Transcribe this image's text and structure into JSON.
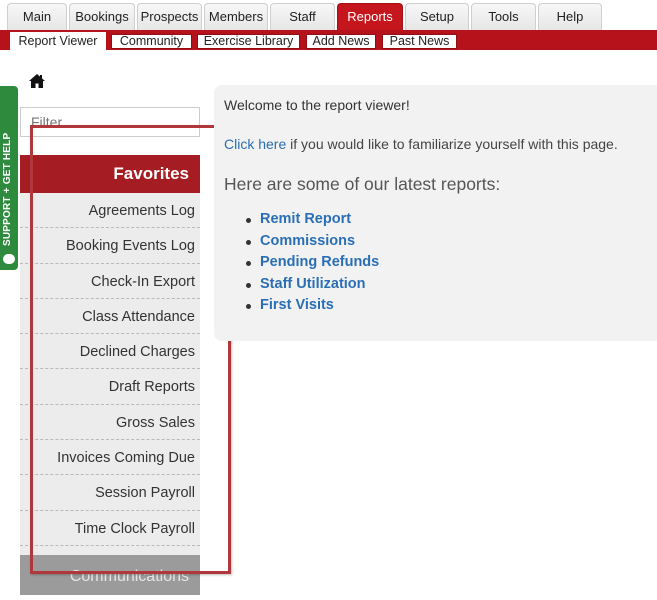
{
  "nav": {
    "tabs": [
      {
        "label": "Main"
      },
      {
        "label": "Bookings"
      },
      {
        "label": "Prospects"
      },
      {
        "label": "Members"
      },
      {
        "label": "Staff"
      },
      {
        "label": "Reports",
        "active": true
      },
      {
        "label": "Setup"
      },
      {
        "label": "Tools"
      },
      {
        "label": "Help"
      }
    ]
  },
  "subnav": {
    "tabs": [
      {
        "label": "Report Viewer",
        "active": true
      },
      {
        "label": "Community"
      },
      {
        "label": "Exercise Library"
      },
      {
        "label": "Add News"
      },
      {
        "label": "Past News"
      }
    ]
  },
  "support": {
    "label": "SUPPORT + GET HELP",
    "icon": "chat-bubble-icon"
  },
  "sidebar": {
    "home_icon": "home-icon",
    "filter_placeholder": "Filter",
    "favorites_heading": "Favorites",
    "favorites": [
      "Agreements Log",
      "Booking Events Log",
      "Check-In Export",
      "Class Attendance",
      "Declined Charges",
      "Draft Reports",
      "Gross Sales",
      "Invoices Coming Due",
      "Session Payroll",
      "Time Clock Payroll"
    ],
    "next_section": "Communications"
  },
  "main": {
    "welcome": "Welcome to the report viewer!",
    "click_link": "Click here",
    "click_rest": " if you would like to familiarize yourself with this page.",
    "latest_heading": "Here are some of our latest reports:",
    "latest_reports": [
      "Remit Report",
      "Commissions",
      "Pending Refunds",
      "Staff Utilization",
      "First Visits"
    ]
  },
  "colors": {
    "brand_red": "#c4161c",
    "link_blue": "#2a6fb5",
    "support_green": "#2e8b3e",
    "annotation_red": "#b0383c"
  }
}
